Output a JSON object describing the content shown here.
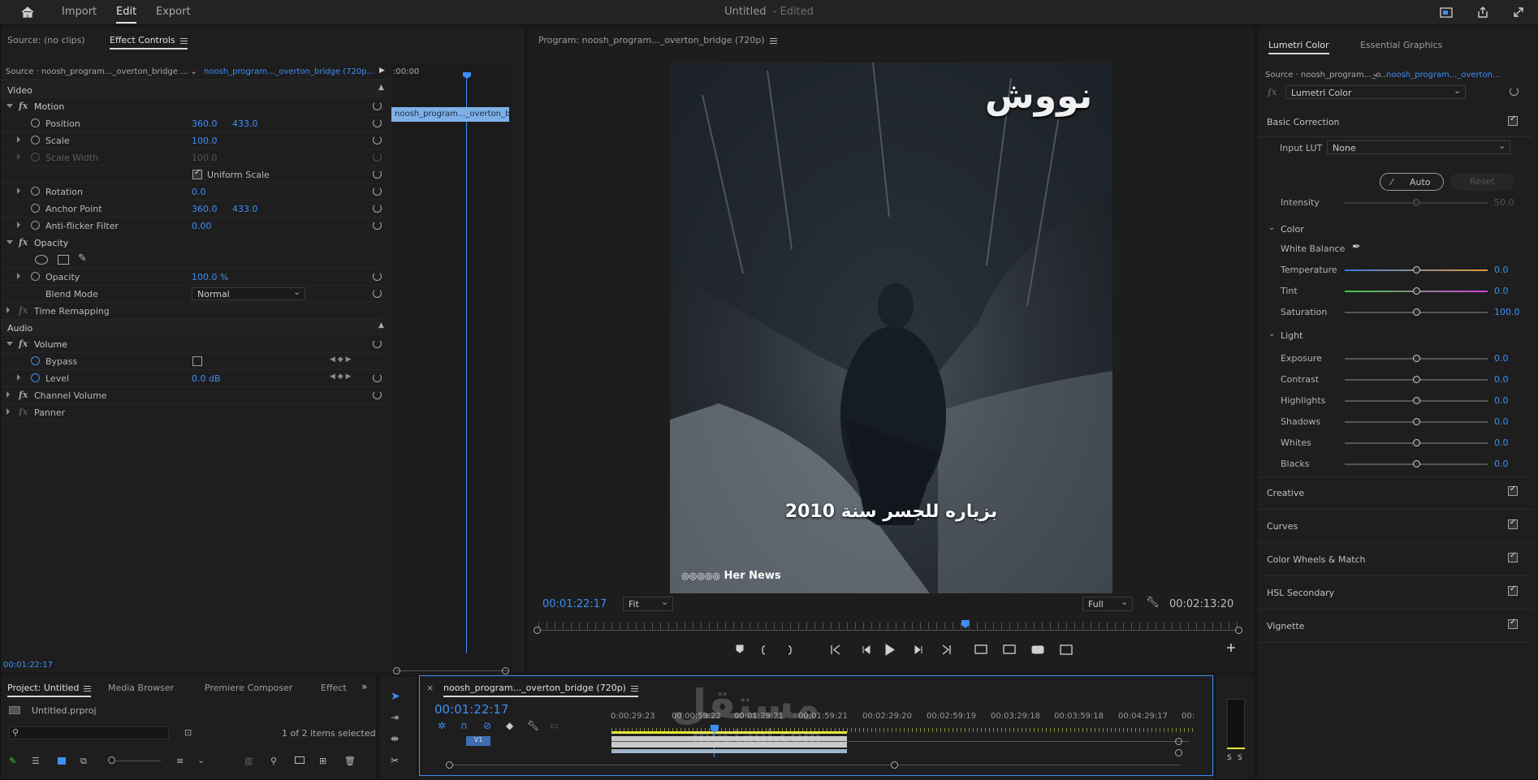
{
  "topbar": {
    "nav": [
      "Import",
      "Edit",
      "Export"
    ],
    "doc_title": "Untitled",
    "doc_status": "- Edited",
    "icons": [
      "home-icon",
      "quick-export-icon",
      "share-icon",
      "maximize-icon"
    ]
  },
  "source_panel": {
    "tab_source": "Source: (no clips)",
    "tab_effects": "Effect Controls"
  },
  "effect_controls": {
    "source_label": "Source · noosh_program..._overton_bridge ...",
    "sequence_label": "noosh_program..._overton_bridge (720p...",
    "mini_timecode": ":00:00",
    "clip_label": "noosh_program..._overton_bri",
    "video_header": "Video",
    "audio_header": "Audio",
    "rows": {
      "motion": "Motion",
      "position": "Position",
      "position_x": "360.0",
      "position_y": "433.0",
      "scale": "Scale",
      "scale_val": "100.0",
      "scale_width": "Scale Width",
      "scale_width_val": "100.0",
      "uniform_scale": "Uniform Scale",
      "rotation": "Rotation",
      "rotation_val": "0.0",
      "anchor": "Anchor Point",
      "anchor_x": "360.0",
      "anchor_y": "433.0",
      "antiflicker": "Anti-flicker Filter",
      "antiflicker_val": "0.00",
      "opacity_group": "Opacity",
      "opacity": "Opacity",
      "opacity_val": "100.0 %",
      "blend": "Blend Mode",
      "blend_val": "Normal",
      "time_remap": "Time Remapping",
      "volume": "Volume",
      "bypass": "Bypass",
      "level": "Level",
      "level_val": "0.0 dB",
      "channel_volume": "Channel Volume",
      "panner": "Panner"
    },
    "footer_timecode": "00:01:22:17"
  },
  "program": {
    "title": "Program: noosh_program..._overton_bridge (720p)",
    "logo_text": "نووش",
    "caption": "بزياره للجسر سنة 2010",
    "credit": "Her News",
    "timecode": "00:01:22:17",
    "fit": "Fit",
    "quality": "Full",
    "duration": "00:02:13:20",
    "playhead_fraction": 0.61
  },
  "lumetri": {
    "tab_lumetri": "Lumetri Color",
    "tab_graphics": "Essential Graphics",
    "source_label": "Source · noosh_program..._o...",
    "seq_label": "noosh_program..._overton...",
    "effect_select": "Lumetri Color",
    "basic_correction": "Basic Correction",
    "input_lut_label": "Input LUT",
    "input_lut_val": "None",
    "auto": "Auto",
    "reset": "Reset",
    "intensity_label": "Intensity",
    "intensity_val": "50.0",
    "color_header": "Color",
    "white_balance": "White Balance",
    "temperature": "Temperature",
    "temperature_val": "0.0",
    "tint": "Tint",
    "tint_val": "0.0",
    "saturation": "Saturation",
    "saturation_val": "100.0",
    "light_header": "Light",
    "exposure": "Exposure",
    "exposure_val": "0.0",
    "contrast": "Contrast",
    "contrast_val": "0.0",
    "highlights": "Highlights",
    "highlights_val": "0.0",
    "shadows": "Shadows",
    "shadows_val": "0.0",
    "whites": "Whites",
    "whites_val": "0.0",
    "blacks": "Blacks",
    "blacks_val": "0.0",
    "sections": [
      "Creative",
      "Curves",
      "Color Wheels & Match",
      "HSL Secondary",
      "Vignette"
    ]
  },
  "project": {
    "tabs": [
      "Project: Untitled",
      "Media Browser",
      "Premiere Composer",
      "Effect"
    ],
    "file": "Untitled.prproj",
    "selection": "1 of 2 items selected"
  },
  "timeline": {
    "sequence_tab": "noosh_program..._overton_bridge (720p)",
    "timecode": "00:01:22:17",
    "ruler": [
      "0:00:29:23",
      "00:00:59:22",
      "00:01:29:21",
      "00:01:59:21",
      "00:02:29:20",
      "00:02:59:19",
      "00:03:29:18",
      "00:03:59:18",
      "00:04:29:17",
      "00:"
    ],
    "track_v1": "V1",
    "watermark": "مستقل",
    "watermark_url": "mostaql.com",
    "meter_labels": [
      "S",
      "S"
    ]
  }
}
